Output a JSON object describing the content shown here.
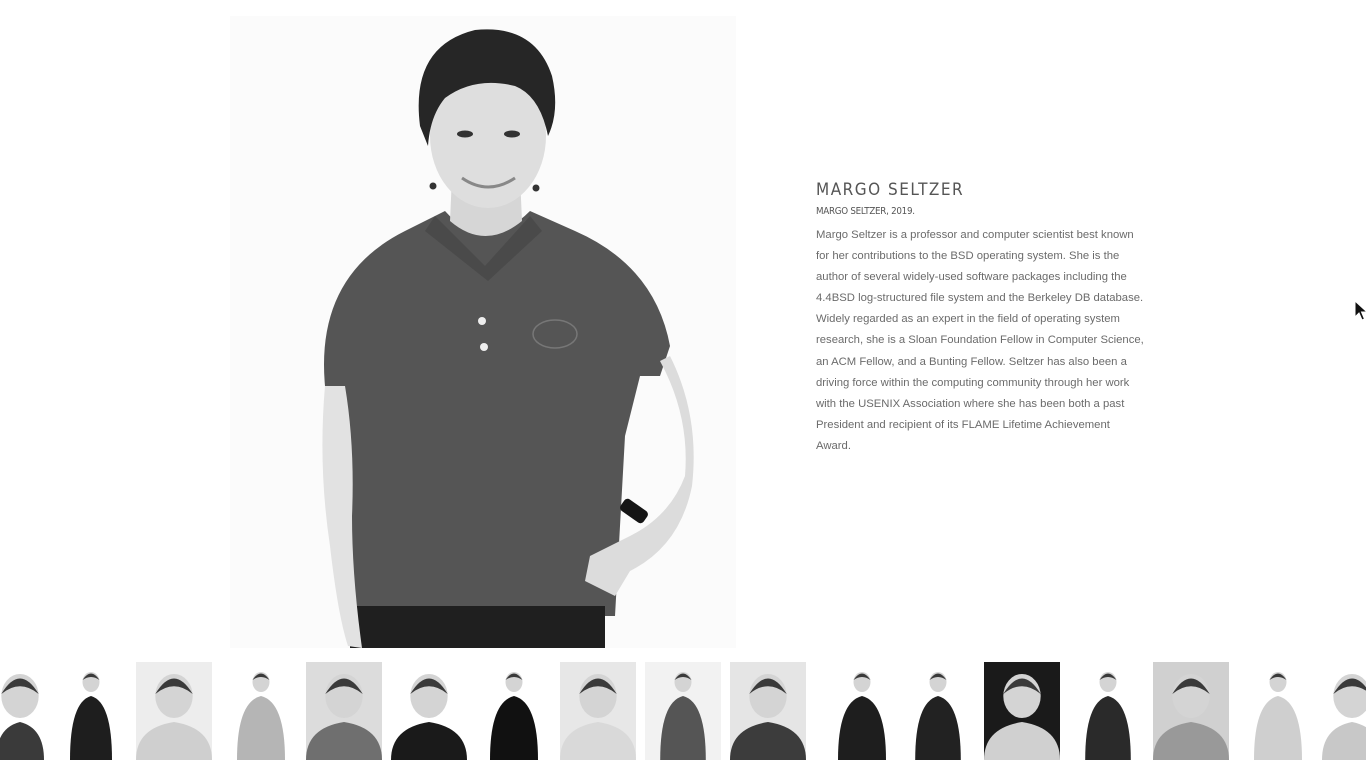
{
  "profile": {
    "name": "MARGO SELTZER",
    "caption": "MARGO SELTZER, 2019.",
    "bio": "Margo Seltzer is a professor and computer scientist best known for her contributions to the BSD operating system. She is the author of several widely-used software packages including the 4.4BSD log-structured file system and the Berkeley DB database. Widely regarded as an expert in the field of operating system research, she is a Sloan Foundation Fellow in Computer Science, an ACM Fellow, and a Bunting Fellow. Seltzer has also been a driving force within the computing community through her work with the USENIX Association where she has been both a past President and recipient of its FLAME Lifetime Achievement Award."
  },
  "colors": {
    "background": "#ffffff",
    "heading": "#555555",
    "body_text": "#6b6b6b"
  },
  "icons": {
    "cursor": "mouse-pointer-icon"
  }
}
